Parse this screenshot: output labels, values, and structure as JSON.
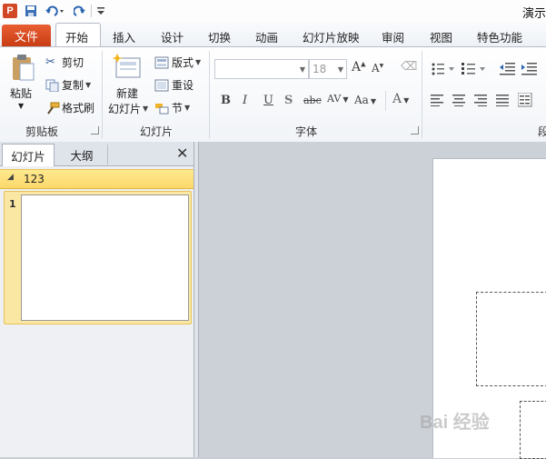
{
  "window": {
    "title": "演示"
  },
  "ribbon_tabs": {
    "file": "文件",
    "home": "开始",
    "insert": "插入",
    "design": "设计",
    "transitions": "切换",
    "animations": "动画",
    "slideshow": "幻灯片放映",
    "review": "审阅",
    "view": "视图",
    "special": "特色功能"
  },
  "clipboard": {
    "paste": "粘贴",
    "cut": "剪切",
    "copy": "复制",
    "format_painter": "格式刷",
    "group_label": "剪贴板"
  },
  "slides_group": {
    "new_slide_line1": "新建",
    "new_slide_line2": "幻灯片",
    "layout": "版式",
    "reset": "重设",
    "section": "节",
    "group_label": "幻灯片"
  },
  "font_group": {
    "font_name": "",
    "font_size": "18",
    "bold": "B",
    "italic": "I",
    "underline": "U",
    "shadow": "S",
    "strike": "abc",
    "spacing": "AV",
    "case": "Aa",
    "color": "A",
    "group_label": "字体"
  },
  "paragraph_group": {
    "group_label": "段"
  },
  "left_pane": {
    "tab_slides": "幻灯片",
    "tab_outline": "大纲",
    "close": "✕",
    "section_name": "123",
    "slide_number": "1"
  },
  "watermark": {
    "text": "Bai 经验"
  },
  "colors": {
    "file_tab": "#d24726",
    "accent": "#2b579a",
    "section_bar": "#fcd86a"
  }
}
